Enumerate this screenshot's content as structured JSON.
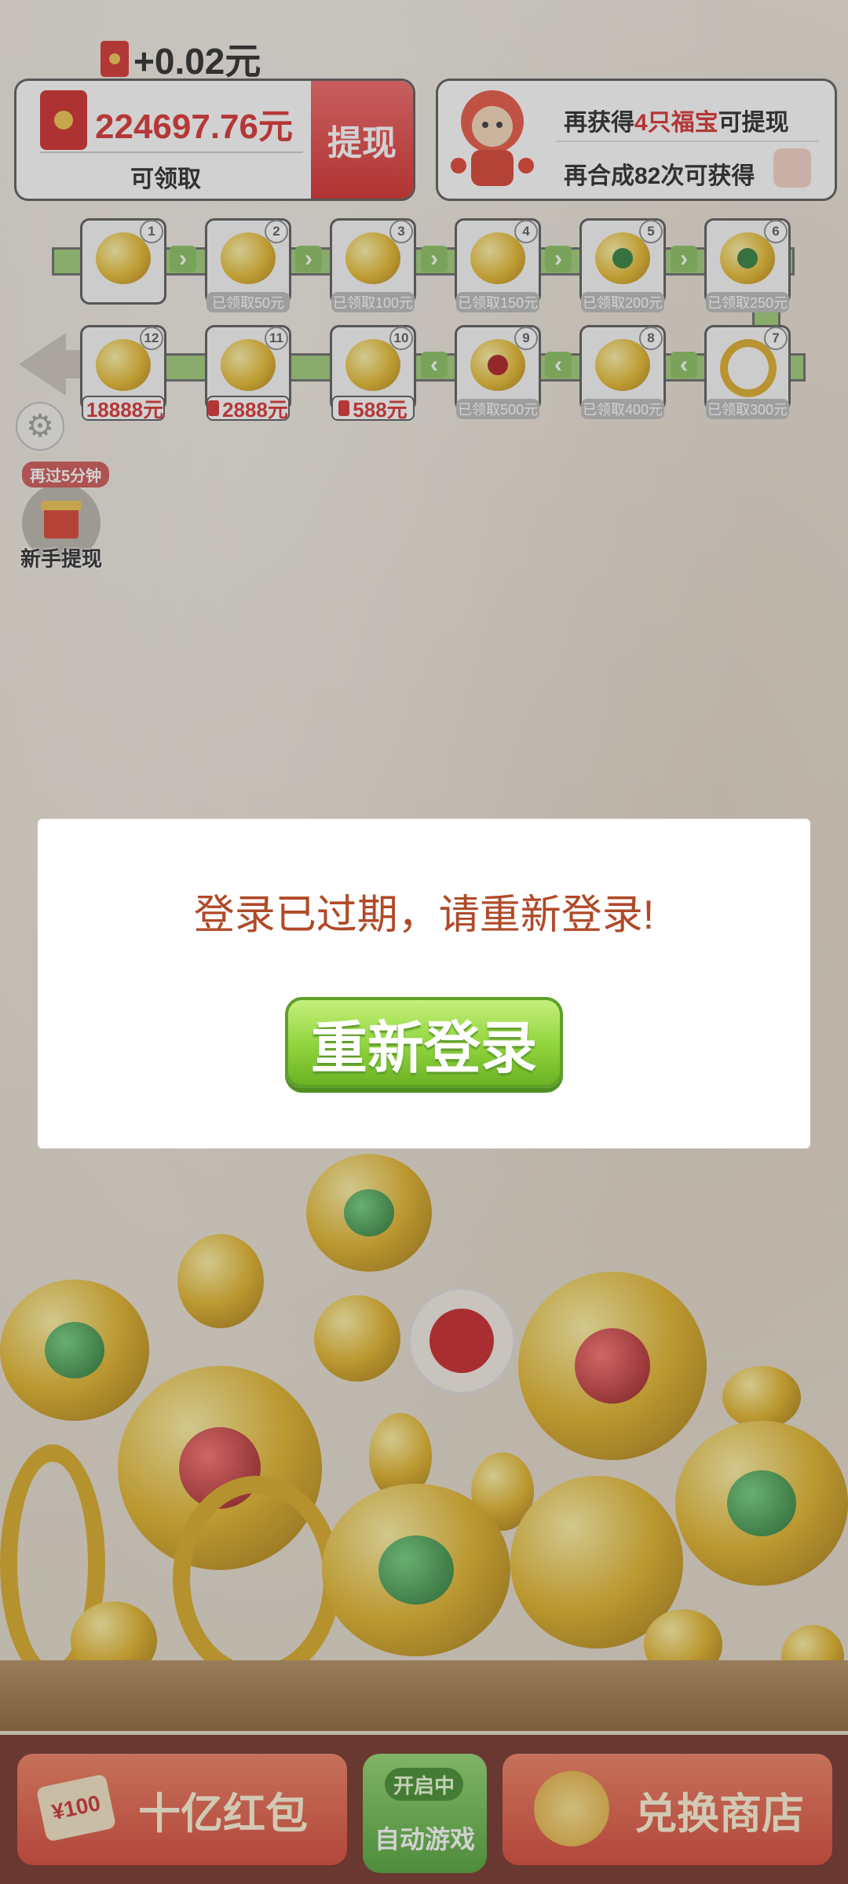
{
  "header": {
    "reward_popup": "+0.02元",
    "balance": {
      "amount": "224697.76元",
      "label": "可领取",
      "withdraw_label": "提现"
    },
    "goal": {
      "line1_prefix": "再获得",
      "line1_highlight": "4只福宝",
      "line1_suffix": "可提现",
      "line2": "再合成82次可获得"
    }
  },
  "progress": {
    "tiles": [
      {
        "num": "1",
        "label": "",
        "kind": "gold"
      },
      {
        "num": "2",
        "label": "已领取50元",
        "kind": "gold"
      },
      {
        "num": "3",
        "label": "已领取100元",
        "kind": "gold"
      },
      {
        "num": "4",
        "label": "已领取150元",
        "kind": "gold"
      },
      {
        "num": "5",
        "label": "已领取200元",
        "kind": "jade"
      },
      {
        "num": "6",
        "label": "已领取250元",
        "kind": "jade"
      },
      {
        "num": "7",
        "label": "已领取300元",
        "kind": "ring"
      },
      {
        "num": "8",
        "label": "已领取400元",
        "kind": "gold"
      },
      {
        "num": "9",
        "label": "已领取500元",
        "kind": "ruby"
      },
      {
        "num": "10",
        "label": "588元",
        "kind": "gold"
      },
      {
        "num": "11",
        "label": "2888元",
        "kind": "gold"
      },
      {
        "num": "12",
        "label": "18888元",
        "kind": "gold"
      }
    ]
  },
  "newbie": {
    "timer": "再过5分钟",
    "label": "新手提现"
  },
  "bottom": {
    "bill_coin": "¥100",
    "bill_label": "十亿红包",
    "auto_status": "开启中",
    "auto_label": "自动游戏",
    "shop_label": "兑换商店"
  },
  "dialog": {
    "message": "登录已过期，请重新登录!",
    "button_label": "重新登录"
  },
  "colors": {
    "accent_red": "#d82a2a",
    "button_green": "#8fd33c",
    "dialog_text": "#b04a28"
  }
}
